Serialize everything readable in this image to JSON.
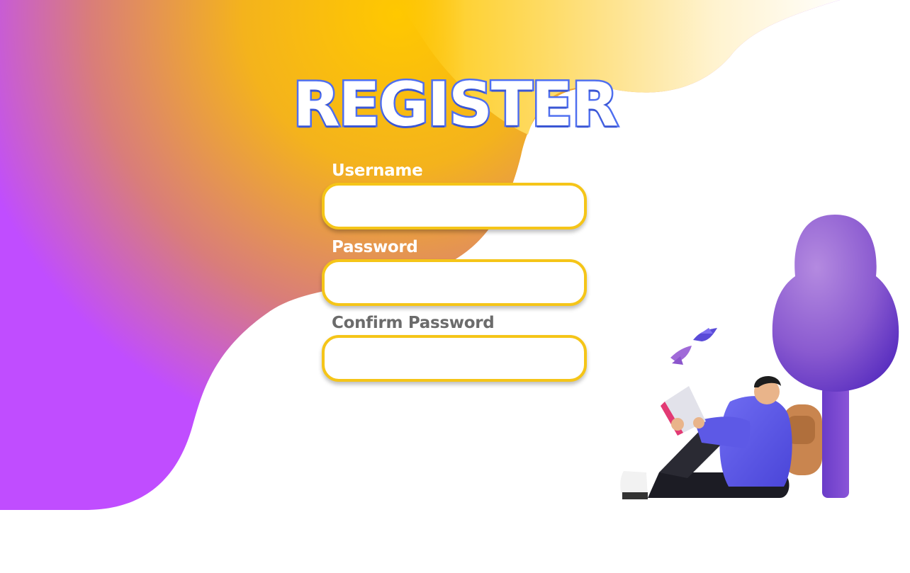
{
  "title": "REGISTER",
  "form": {
    "fields": [
      {
        "label": "Username",
        "value": "",
        "placeholder": ""
      },
      {
        "label": "Password",
        "value": "",
        "placeholder": ""
      },
      {
        "label": "Confirm Password",
        "value": "",
        "placeholder": ""
      }
    ]
  },
  "colors": {
    "title_stroke": "#4f6ff0",
    "input_border": "#f5c518",
    "blob_purple": "#c04cff",
    "blob_yellow": "#ffc700"
  },
  "icons": {
    "illustration": "student-reading-under-tree-illustration"
  }
}
